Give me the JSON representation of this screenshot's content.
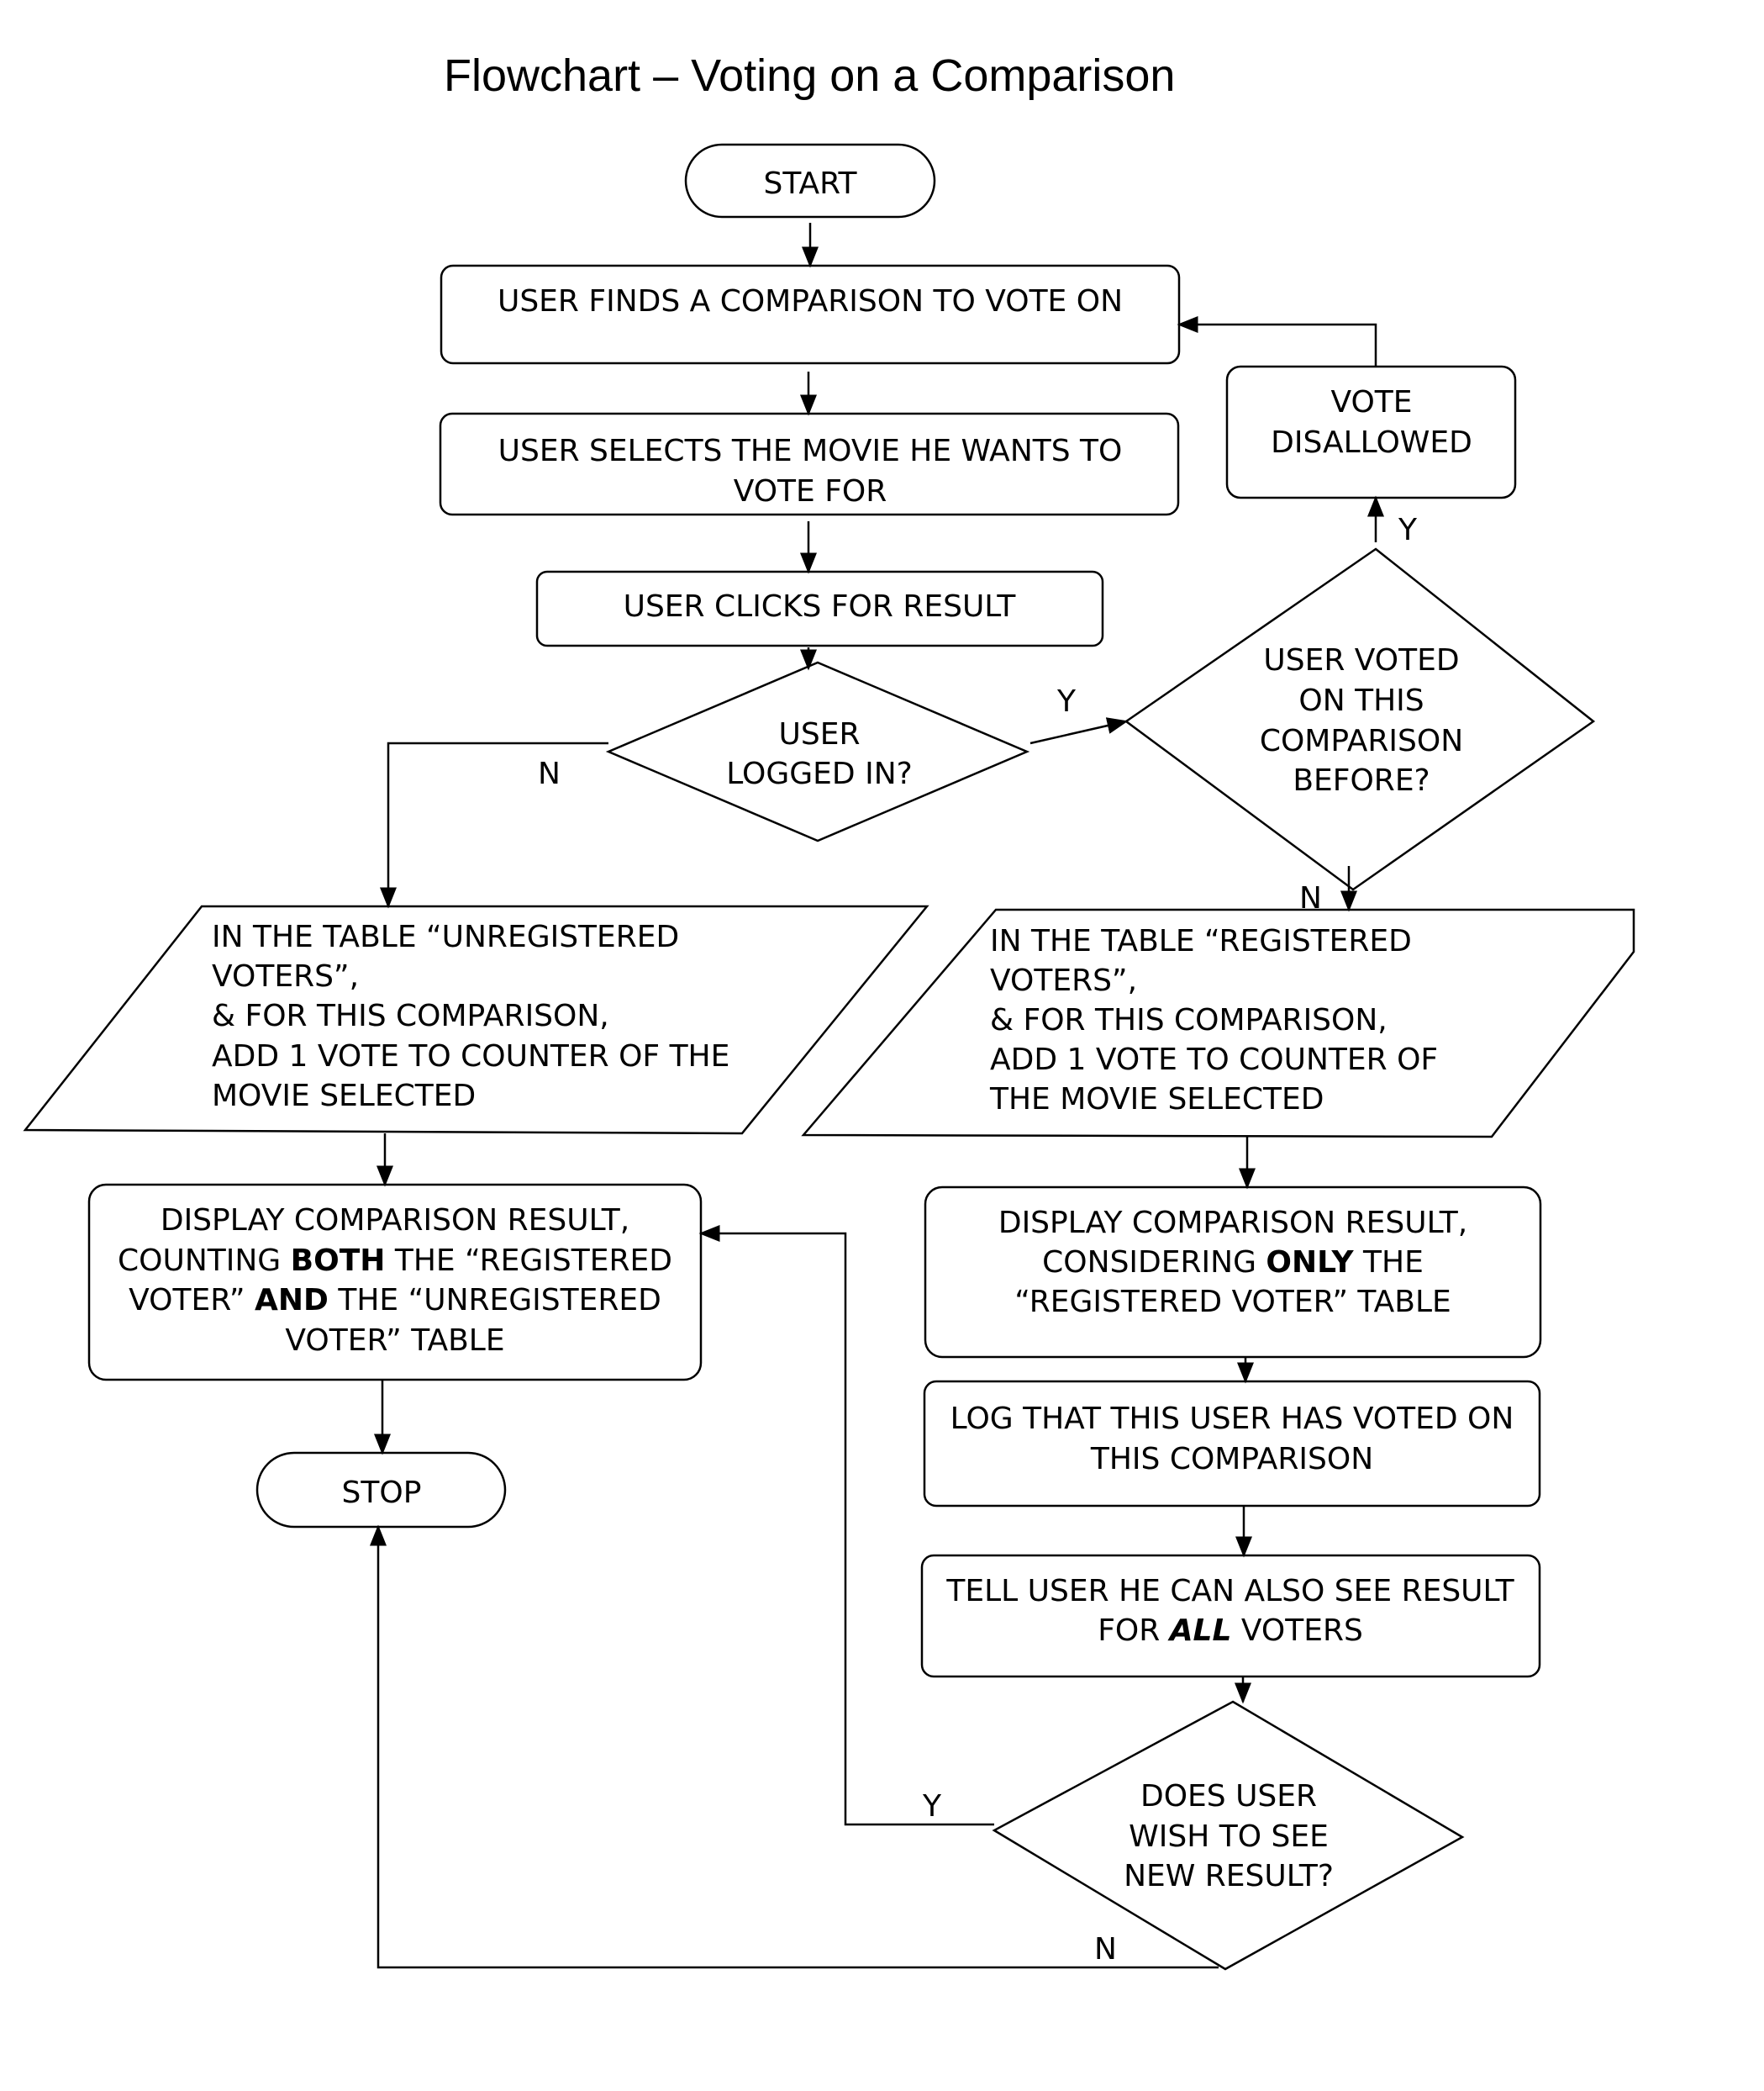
{
  "title": "Flowchart – Voting on a Comparison",
  "nodes": {
    "start": "START",
    "find": "USER FINDS A COMPARISON TO VOTE ON",
    "select": [
      "USER SELECTS THE MOVIE HE WANTS TO",
      "VOTE FOR"
    ],
    "click": "USER CLICKS FOR RESULT",
    "logged_in": [
      "USER",
      "LOGGED IN?"
    ],
    "voted_before": [
      "USER VOTED",
      "ON THIS",
      "COMPARISON",
      "BEFORE?"
    ],
    "disallowed": [
      "VOTE",
      "DISALLOWED"
    ],
    "unreg_table": [
      "IN THE TABLE “UNREGISTERED",
      "VOTERS”,",
      "& FOR THIS COMPARISON,",
      "ADD 1 VOTE TO COUNTER OF THE",
      "MOVIE SELECTED"
    ],
    "reg_table": [
      "IN THE TABLE “REGISTERED",
      "VOTERS”,",
      "& FOR THIS COMPARISON,",
      "ADD 1 VOTE TO COUNTER OF",
      "THE MOVIE SELECTED"
    ],
    "display_both": {
      "l1": "DISPLAY COMPARISON RESULT,",
      "l2a": "COUNTING ",
      "l2b": "BOTH",
      "l2c": " THE “REGISTERED",
      "l3a": "VOTER” ",
      "l3b": "AND",
      "l3c": " THE “UNREGISTERED",
      "l4": "VOTER” TABLE"
    },
    "display_only": {
      "l1": "DISPLAY COMPARISON RESULT,",
      "l2a": "CONSIDERING ",
      "l2b": "ONLY",
      "l2c": " THE",
      "l3": "“REGISTERED VOTER” TABLE"
    },
    "log": [
      "LOG THAT THIS USER HAS VOTED ON",
      "THIS COMPARISON"
    ],
    "tell": {
      "l1": "TELL USER HE CAN ALSO SEE RESULT",
      "l2a": "FOR ",
      "l2b": "ALL",
      "l2c": " VOTERS"
    },
    "wish": [
      "DOES USER",
      "WISH TO SEE",
      "NEW RESULT?"
    ],
    "stop": "STOP"
  },
  "labels": {
    "yes": "Y",
    "no": "N"
  }
}
